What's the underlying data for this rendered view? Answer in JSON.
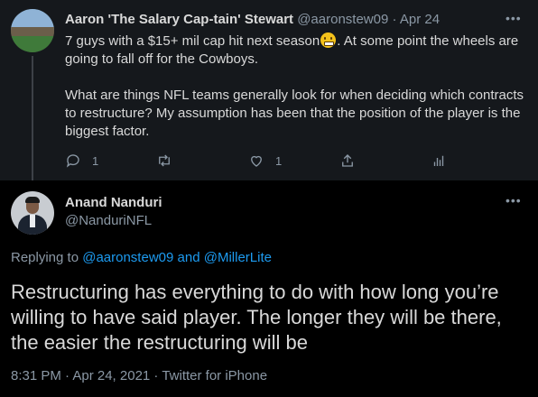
{
  "parent_tweet": {
    "display_name": "Aaron 'The Salary Cap-tain' Stewart",
    "handle": "@aaronstew09",
    "separator": " · ",
    "date": "Apr 24",
    "more_label": "•••",
    "text_line1_before_emoji": "7 guys with a $15+ mil cap hit next season",
    "emoji": "grimacing-face",
    "text_line1_after_emoji": ". At some point the wheels are going to fall off for the Cowboys.",
    "text_paragraph2": "What are things NFL teams generally look for when deciding which contracts to restructure? My assumption has been that the position of the player is the biggest factor.",
    "reply_count": "1",
    "like_count": "1"
  },
  "focus_tweet": {
    "display_name": "Anand Nanduri",
    "handle": "@NanduriNFL",
    "more_label": "•••",
    "replying_prefix": "Replying to ",
    "replying_user1": "@aaronstew09",
    "replying_and": " and ",
    "replying_user2": "@MillerLite",
    "text": "Restructuring has everything to do with how long you’re willing to have said player. The longer they will be there, the easier the restructuring will be",
    "timestamp": "8:31 PM · Apr 24, 2021",
    "source_separator": " · ",
    "source": "Twitter for iPhone"
  },
  "colors": {
    "background": "#000000",
    "parent_background": "#15181c",
    "text": "#d9d9d9",
    "muted": "#8b98a5",
    "link": "#1d9bf0"
  }
}
